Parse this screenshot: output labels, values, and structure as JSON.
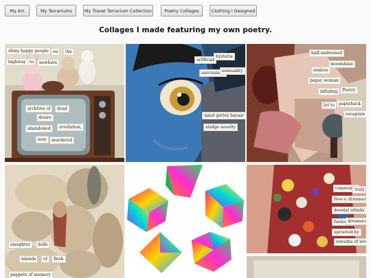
{
  "nav": {
    "buttons": [
      {
        "label": "My Art"
      },
      {
        "label": "My Terrariums"
      },
      {
        "label": "My Travel Terrarium Collection"
      },
      {
        "label": "Poetry Collages"
      },
      {
        "label": "Clothing I Designed"
      }
    ]
  },
  "page": {
    "heading": "Collages I made featuring my own poetry."
  },
  "collages": {
    "tv": {
      "words": [
        "shiny happy people",
        "on",
        "the",
        "highway",
        "to",
        "nowhere",
        "archives of",
        "dead",
        "desire",
        "abandoned",
        "revolution,",
        "now",
        "murdered"
      ]
    },
    "face": {
      "words": [
        "artificial",
        "hysteria",
        "narcissistic",
        "sensuality",
        "mind gutter",
        "bazaar",
        "sludge novelty"
      ]
    },
    "woman": {
      "words": [
        "half-undressed",
        "moonshine",
        "sexless",
        "pagan",
        "woman",
        "inflating",
        "Poetry",
        "lot to",
        "paperback",
        "escapism"
      ]
    },
    "yarn": {
      "words": [
        "slaughter",
        "dolls",
        "islands",
        "of",
        "flesh",
        "puppets of memory"
      ]
    },
    "buttons": {
      "words": [
        "communal",
        "truly",
        "free-spirited",
        "dreamers",
        "desolate",
        "whisky",
        "fueled by",
        "dreamscapes",
        "uprooted by",
        "wreaths of lovers"
      ]
    }
  }
}
